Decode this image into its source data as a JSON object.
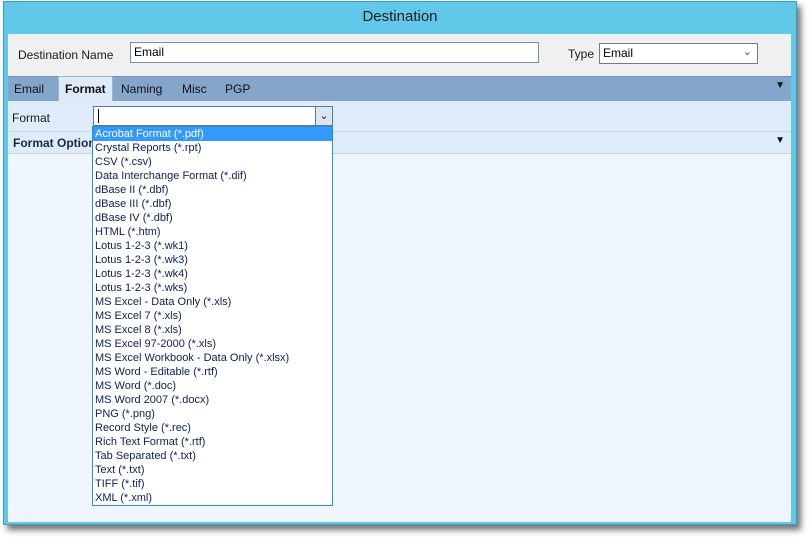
{
  "window": {
    "title": "Destination"
  },
  "destination": {
    "name_label": "Destination Name",
    "name_value": "Email",
    "type_label": "Type",
    "type_value": "Email",
    "type_chevron": "⌄"
  },
  "tabs": [
    {
      "label": "Email",
      "active": false
    },
    {
      "label": "Format",
      "active": true
    },
    {
      "label": "Naming",
      "active": false
    },
    {
      "label": "Misc",
      "active": false
    },
    {
      "label": "PGP",
      "active": false
    }
  ],
  "tab_menu_icon": "▼",
  "format": {
    "label": "Format",
    "value": "",
    "dropdown_icon": "⌄",
    "options_title": "Format Options",
    "options_menu_icon": "▼",
    "selected_index": 0,
    "options": [
      "Acrobat Format (*.pdf)",
      "Crystal Reports (*.rpt)",
      "CSV (*.csv)",
      "Data Interchange Format (*.dif)",
      "dBase II (*.dbf)",
      "dBase III (*.dbf)",
      "dBase IV (*.dbf)",
      "HTML (*.htm)",
      "Lotus 1-2-3 (*.wk1)",
      "Lotus 1-2-3 (*.wk3)",
      "Lotus 1-2-3 (*.wk4)",
      "Lotus 1-2-3 (*.wks)",
      "MS Excel - Data Only (*.xls)",
      "MS Excel 7 (*.xls)",
      "MS Excel 8 (*.xls)",
      "MS Excel 97-2000 (*.xls)",
      "MS Excel Workbook - Data Only (*.xlsx)",
      "MS Word - Editable (*.rtf)",
      "MS Word (*.doc)",
      "MS Word 2007 (*.docx)",
      "PNG (*.png)",
      "Record Style (*.rec)",
      "Rich Text Format (*.rtf)",
      "Tab Separated (*.txt)",
      "Text (*.txt)",
      "TIFF (*.tif)",
      "XML (*.xml)"
    ]
  },
  "colors": {
    "titlebar": "#62c8ea",
    "tabbar": "#86a5cb",
    "selection": "#3399ff"
  }
}
